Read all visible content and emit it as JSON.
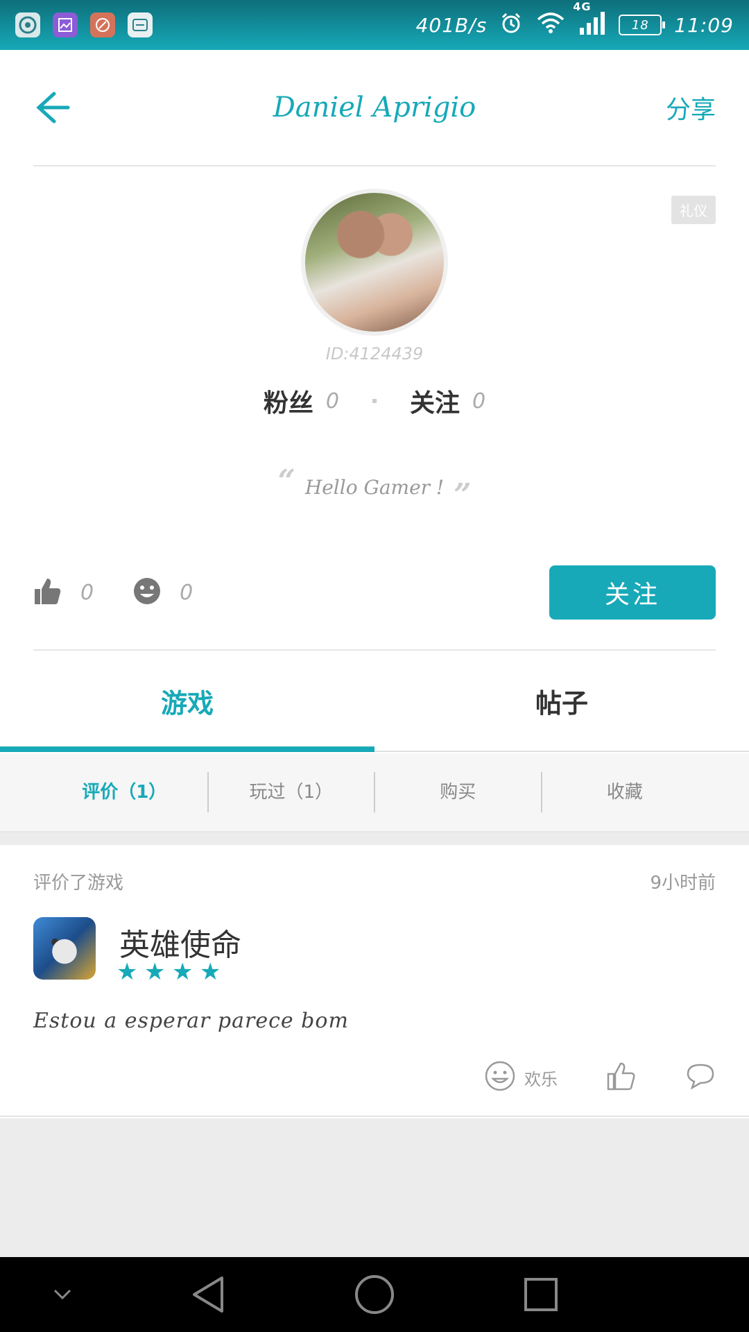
{
  "status_bar": {
    "net_speed": "401B/s",
    "network_type": "4G",
    "battery": "18",
    "time": "11:09",
    "icons": [
      "app-icon-1",
      "gallery-icon",
      "tool-icon",
      "app-icon-4",
      "alarm-icon",
      "wifi-icon",
      "signal-icon",
      "battery-icon"
    ]
  },
  "header": {
    "title": "Daniel Aprigio",
    "share_label": "分享"
  },
  "profile": {
    "badge": "礼仪",
    "user_id": "ID:4124439",
    "fans_label": "粉丝",
    "fans_count": "0",
    "following_label": "关注",
    "following_count": "0",
    "motto": "Hello Gamer !",
    "likes_count": "0",
    "fun_count": "0",
    "follow_button": "关注"
  },
  "main_tabs": [
    {
      "label": "游戏",
      "active": true
    },
    {
      "label": "帖子",
      "active": false
    }
  ],
  "sub_tabs": [
    {
      "label": "评价（1）",
      "active": true
    },
    {
      "label": "玩过（1）",
      "active": false
    },
    {
      "label": "购买",
      "active": false
    },
    {
      "label": "收藏",
      "active": false
    }
  ],
  "review": {
    "action": "评价了游戏",
    "time": "9小时前",
    "game_name": "英雄使命",
    "rating": 4,
    "text": "Estou a esperar parece bom",
    "fun_label": "欢乐"
  },
  "colors": {
    "accent": "#17a9b8",
    "status_bar": "#0d6f7a"
  }
}
